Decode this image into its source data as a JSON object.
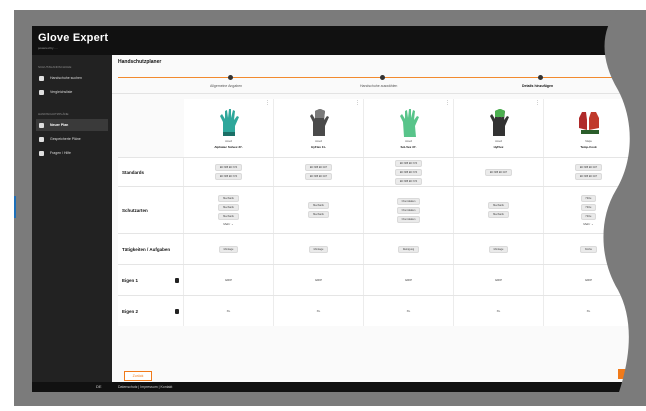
{
  "app": {
    "brand": "Glove Expert",
    "brand_sub": "powered by ...."
  },
  "sidebar": {
    "section1": "Schutzhandschuhe",
    "items_top": [
      {
        "label": "Handschuhe suchen",
        "icon": "download-icon"
      },
      {
        "label": "Vergleichsliste",
        "icon": "compare-icon"
      }
    ],
    "section2": "Handschutzpläne",
    "items_bottom": [
      {
        "label": "Neuer Plan",
        "icon": "document-icon",
        "active": true
      },
      {
        "label": "Gespeicherte Pläne",
        "icon": "folder-icon"
      },
      {
        "label": "Fragen / Hilfe",
        "icon": "pointer-icon"
      }
    ]
  },
  "main": {
    "title": "Handschutzplaner",
    "steps": [
      {
        "label": "Allgemeine Angaben"
      },
      {
        "label": "Handschuhe auswählen"
      },
      {
        "label": "Details hinzufügen",
        "active": true
      }
    ]
  },
  "gloves": [
    {
      "brand": "Ansell",
      "name": "Alphatec Solvex 37-"
    },
    {
      "brand": "Ansell",
      "name": "HyFlex 11-"
    },
    {
      "brand": "Ansell",
      "name": "Sol-Vex 37-"
    },
    {
      "brand": "Ansell",
      "name": "HyFlex"
    },
    {
      "brand": "Mapa",
      "name": "Temp-Cook"
    }
  ],
  "rows": {
    "normen_label": "Standards",
    "schutzarten_label": "Schutzarten",
    "taetigkeiten_label": "Tätigkeiten / Aufgaben",
    "eigen1_label": "Eigen 1",
    "eigen2_label": "Eigen 2"
  },
  "cells": {
    "normen": [
      "EN 388  EN 374",
      "EN 388  EN 407",
      "EN 388  EN 374",
      "EN 388  EN 407",
      "EN 388  EN 407"
    ],
    "schutz": [
      "Mechanik",
      "Mechanik",
      "Chemikalien",
      "Mechanik",
      "Hitze"
    ],
    "taetigkeit": [
      "Montage",
      "Montage",
      "Reinigung",
      "Montage",
      "Küche"
    ],
    "eigen1": [
      "GRIP",
      "GRIP",
      "GRIP",
      "GRIP",
      "GRIP"
    ],
    "eigen2": [
      "XL",
      "XL",
      "XL",
      "XL",
      "XL"
    ],
    "select": "Mehr"
  },
  "footer": {
    "lang": "DE",
    "links": "Datenschutz  |  Impressum  |  Kontakt"
  },
  "buttons": {
    "back": "Zurück"
  },
  "colors": {
    "accent": "#f07a1a",
    "topbar": "#111111",
    "sidebar": "#222222"
  }
}
